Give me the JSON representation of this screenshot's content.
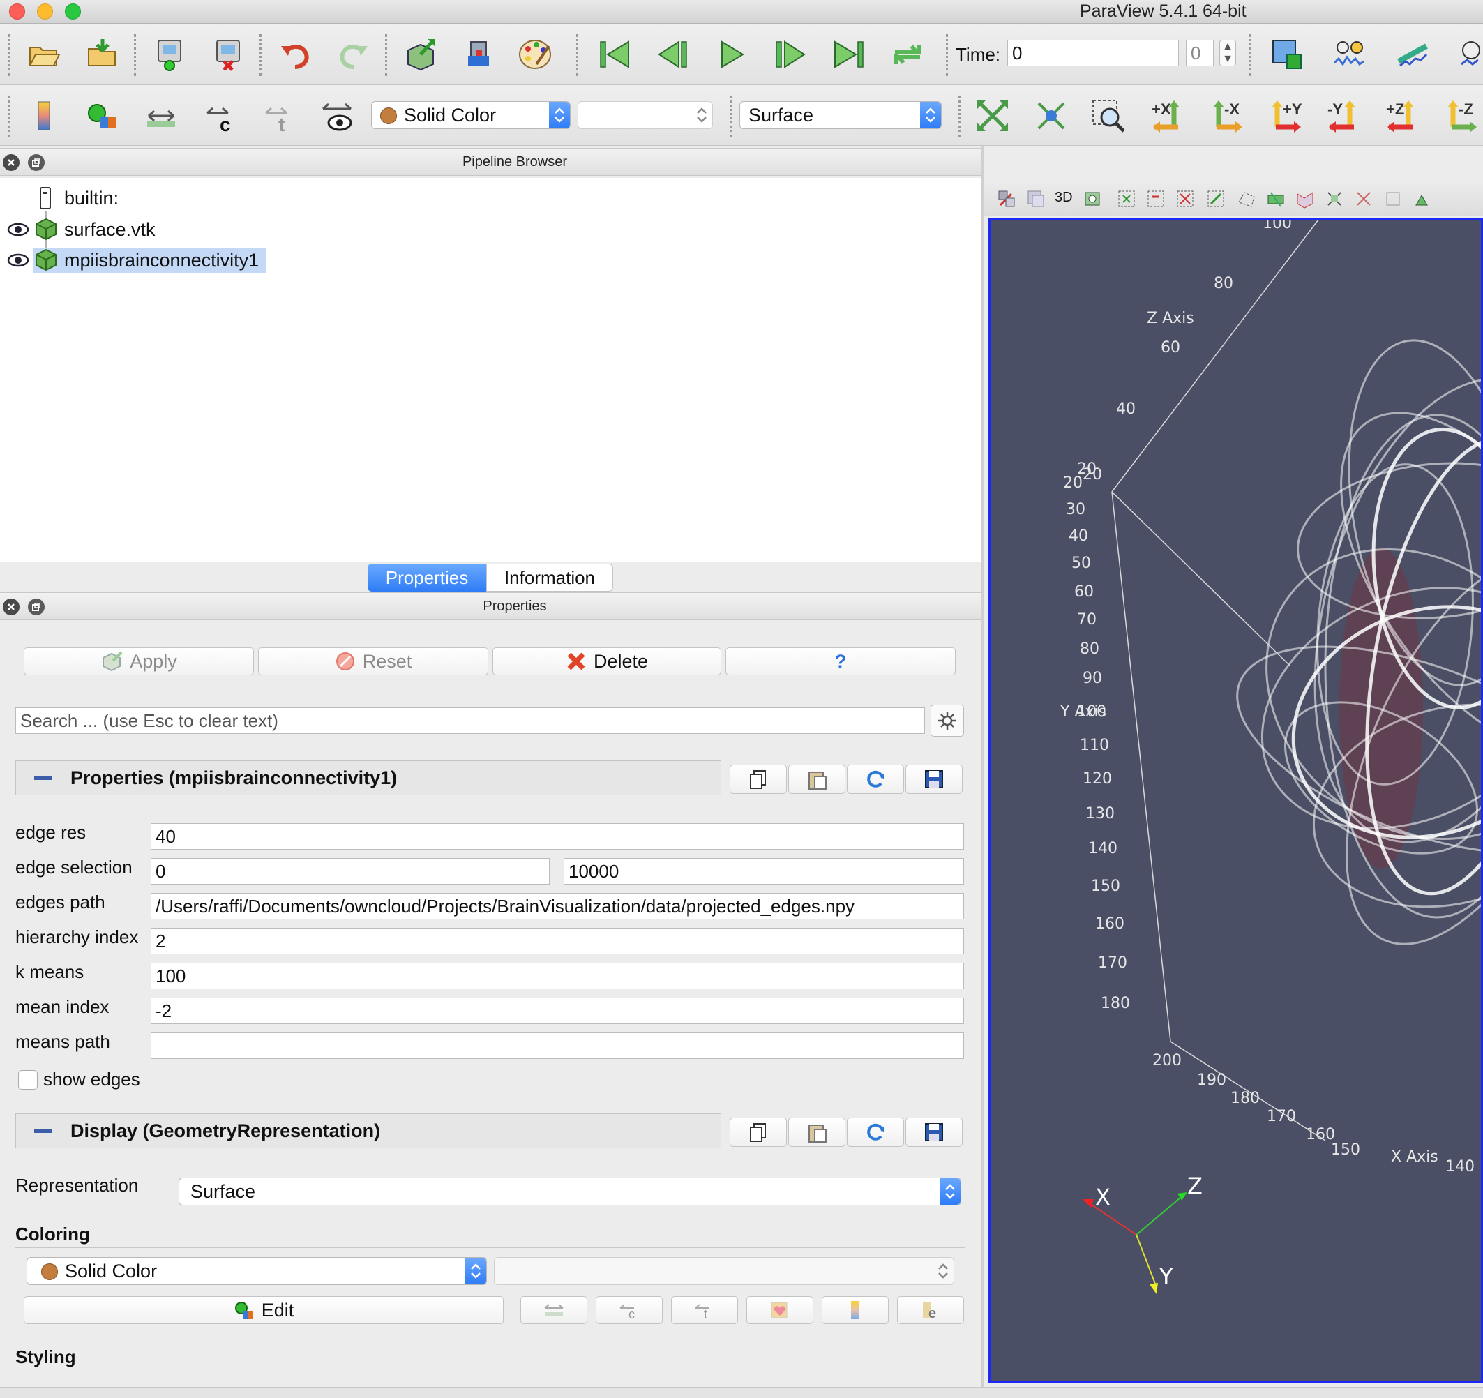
{
  "window": {
    "title": "ParaView 5.4.1 64-bit"
  },
  "toolbar": {
    "time_label": "Time:",
    "time_value": "0",
    "time_step": "0",
    "color_combo": "Solid Color",
    "component_combo": "",
    "representation_combo": "Surface",
    "camera_labels": [
      "+X",
      "-X",
      "+Y",
      "-Y",
      "+Z",
      "-Z"
    ]
  },
  "pipeline": {
    "title": "Pipeline Browser",
    "items": [
      {
        "label": "builtin:"
      },
      {
        "label": "surface.vtk"
      },
      {
        "label": "mpiisbrainconnectivity1"
      }
    ]
  },
  "tabs": {
    "properties": "Properties",
    "information": "Information"
  },
  "properties_panel": {
    "title": "Properties",
    "apply": "Apply",
    "reset": "Reset",
    "delete": "Delete",
    "help": "?",
    "search_placeholder": "Search ... (use Esc to clear text)",
    "section_properties": "Properties (mpiisbrainconnectivity1)",
    "fields": {
      "edge_res_label": "edge res",
      "edge_res": "40",
      "edge_selection_label": "edge selection",
      "edge_selection_min": "0",
      "edge_selection_max": "10000",
      "edges_path_label": "edges path",
      "edges_path": "/Users/raffi/Documents/owncloud/Projects/BrainVisualization/data/projected_edges.npy",
      "hierarchy_index_label": "hierarchy index",
      "hierarchy_index": "2",
      "k_means_label": "k means",
      "k_means": "100",
      "mean_index_label": "mean index",
      "mean_index": "-2",
      "means_path_label": "means path",
      "means_path": "",
      "show_edges_label": "show edges",
      "show_edges": false
    },
    "section_display": "Display (GeometryRepresentation)",
    "representation_label": "Representation",
    "representation_value": "Surface",
    "coloring_heading": "Coloring",
    "coloring_value": "Solid Color",
    "coloring_component": "",
    "edit_label": "Edit",
    "styling_heading": "Styling"
  },
  "render_view": {
    "toolbar_3d": "3D",
    "z_axis_title": "Z Axis",
    "y_axis_title": "Y Axis",
    "x_axis_title": "X Axis",
    "z_ticks": [
      "100",
      "80",
      "60",
      "40",
      "20"
    ],
    "y_ticks": [
      "20",
      "30",
      "40",
      "50",
      "60",
      "70",
      "80",
      "90",
      "100",
      "110",
      "120",
      "130",
      "140",
      "150",
      "160",
      "170",
      "180"
    ],
    "x_ticks": [
      "20",
      "200",
      "190",
      "180",
      "170",
      "160",
      "150",
      "140"
    ],
    "orient_x": "X",
    "orient_y": "Y",
    "orient_z": "Z",
    "background": "#4b4f65",
    "border": "#1c28f5"
  }
}
